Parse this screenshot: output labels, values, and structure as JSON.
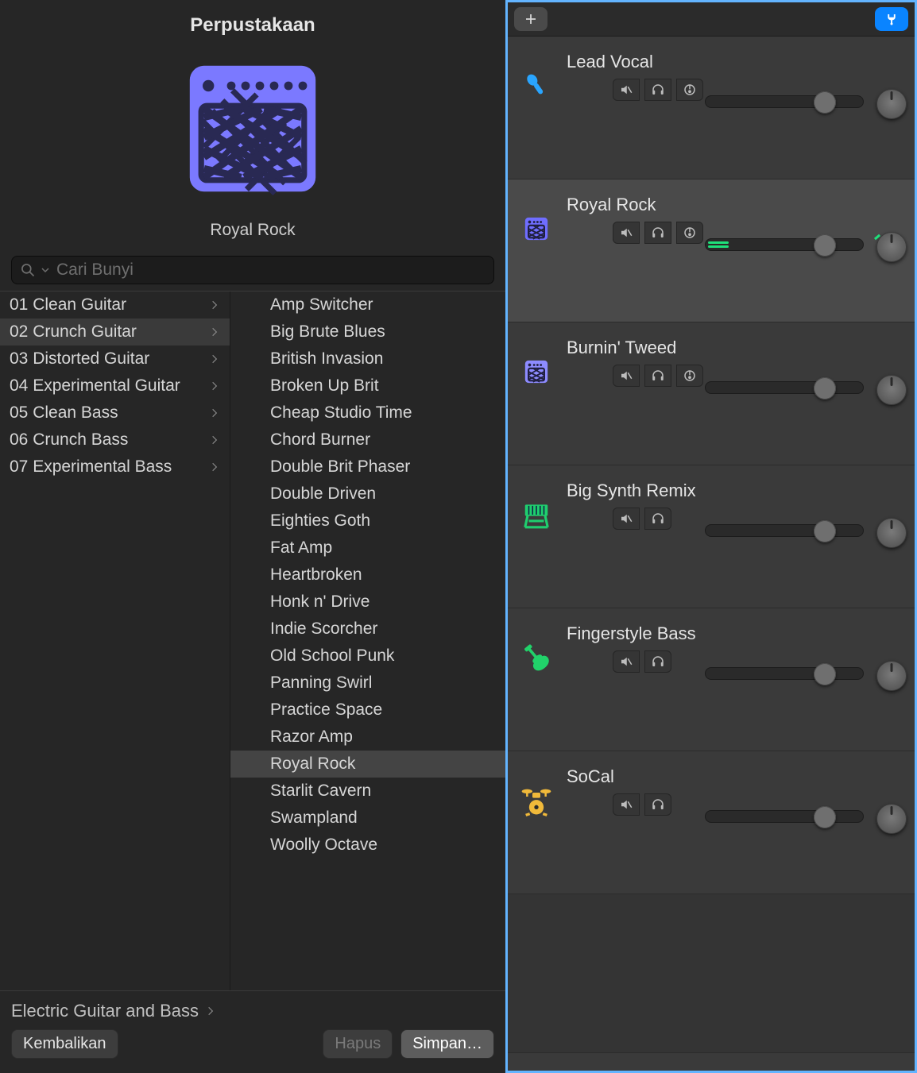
{
  "library": {
    "title": "Perpustakaan",
    "preset_name": "Royal Rock",
    "search_placeholder": "Cari Bunyi",
    "categories": [
      {
        "label": "01 Clean Guitar",
        "selected": false
      },
      {
        "label": "02 Crunch Guitar",
        "selected": true
      },
      {
        "label": "03 Distorted Guitar",
        "selected": false
      },
      {
        "label": "04 Experimental Guitar",
        "selected": false
      },
      {
        "label": "05 Clean Bass",
        "selected": false
      },
      {
        "label": "06 Crunch Bass",
        "selected": false
      },
      {
        "label": "07 Experimental Bass",
        "selected": false
      }
    ],
    "presets": [
      {
        "label": "Amp Switcher"
      },
      {
        "label": "Big Brute Blues"
      },
      {
        "label": "British Invasion"
      },
      {
        "label": "Broken Up Brit"
      },
      {
        "label": "Cheap Studio Time"
      },
      {
        "label": "Chord Burner"
      },
      {
        "label": "Double Brit Phaser"
      },
      {
        "label": "Double Driven"
      },
      {
        "label": "Eighties Goth"
      },
      {
        "label": "Fat Amp"
      },
      {
        "label": "Heartbroken"
      },
      {
        "label": "Honk n' Drive"
      },
      {
        "label": "Indie Scorcher"
      },
      {
        "label": "Old School Punk"
      },
      {
        "label": "Panning Swirl"
      },
      {
        "label": "Practice Space"
      },
      {
        "label": "Razor Amp"
      },
      {
        "label": "Royal Rock",
        "selected": true
      },
      {
        "label": "Starlit Cavern"
      },
      {
        "label": "Swampland"
      },
      {
        "label": "Woolly Octave"
      }
    ],
    "breadcrumb": "Electric Guitar and Bass",
    "buttons": {
      "revert": "Kembalikan",
      "delete": "Hapus",
      "save": "Simpan…"
    }
  },
  "tracks": [
    {
      "name": "Lead Vocal",
      "icon": "mic",
      "color": "#29a5ff",
      "has_input": true,
      "selected": false
    },
    {
      "name": "Royal Rock",
      "icon": "amp",
      "color": "#6f6dff",
      "has_input": true,
      "selected": true,
      "level": true
    },
    {
      "name": "Burnin' Tweed",
      "icon": "amp",
      "color": "#8d8bff",
      "has_input": true,
      "selected": false
    },
    {
      "name": "Big Synth Remix",
      "icon": "synth",
      "color": "#1fce6e",
      "has_input": false,
      "selected": false
    },
    {
      "name": "Fingerstyle Bass",
      "icon": "bass",
      "color": "#21d26a",
      "has_input": false,
      "selected": false
    },
    {
      "name": "SoCal",
      "icon": "drums",
      "color": "#f0b93a",
      "has_input": false,
      "selected": false
    }
  ]
}
